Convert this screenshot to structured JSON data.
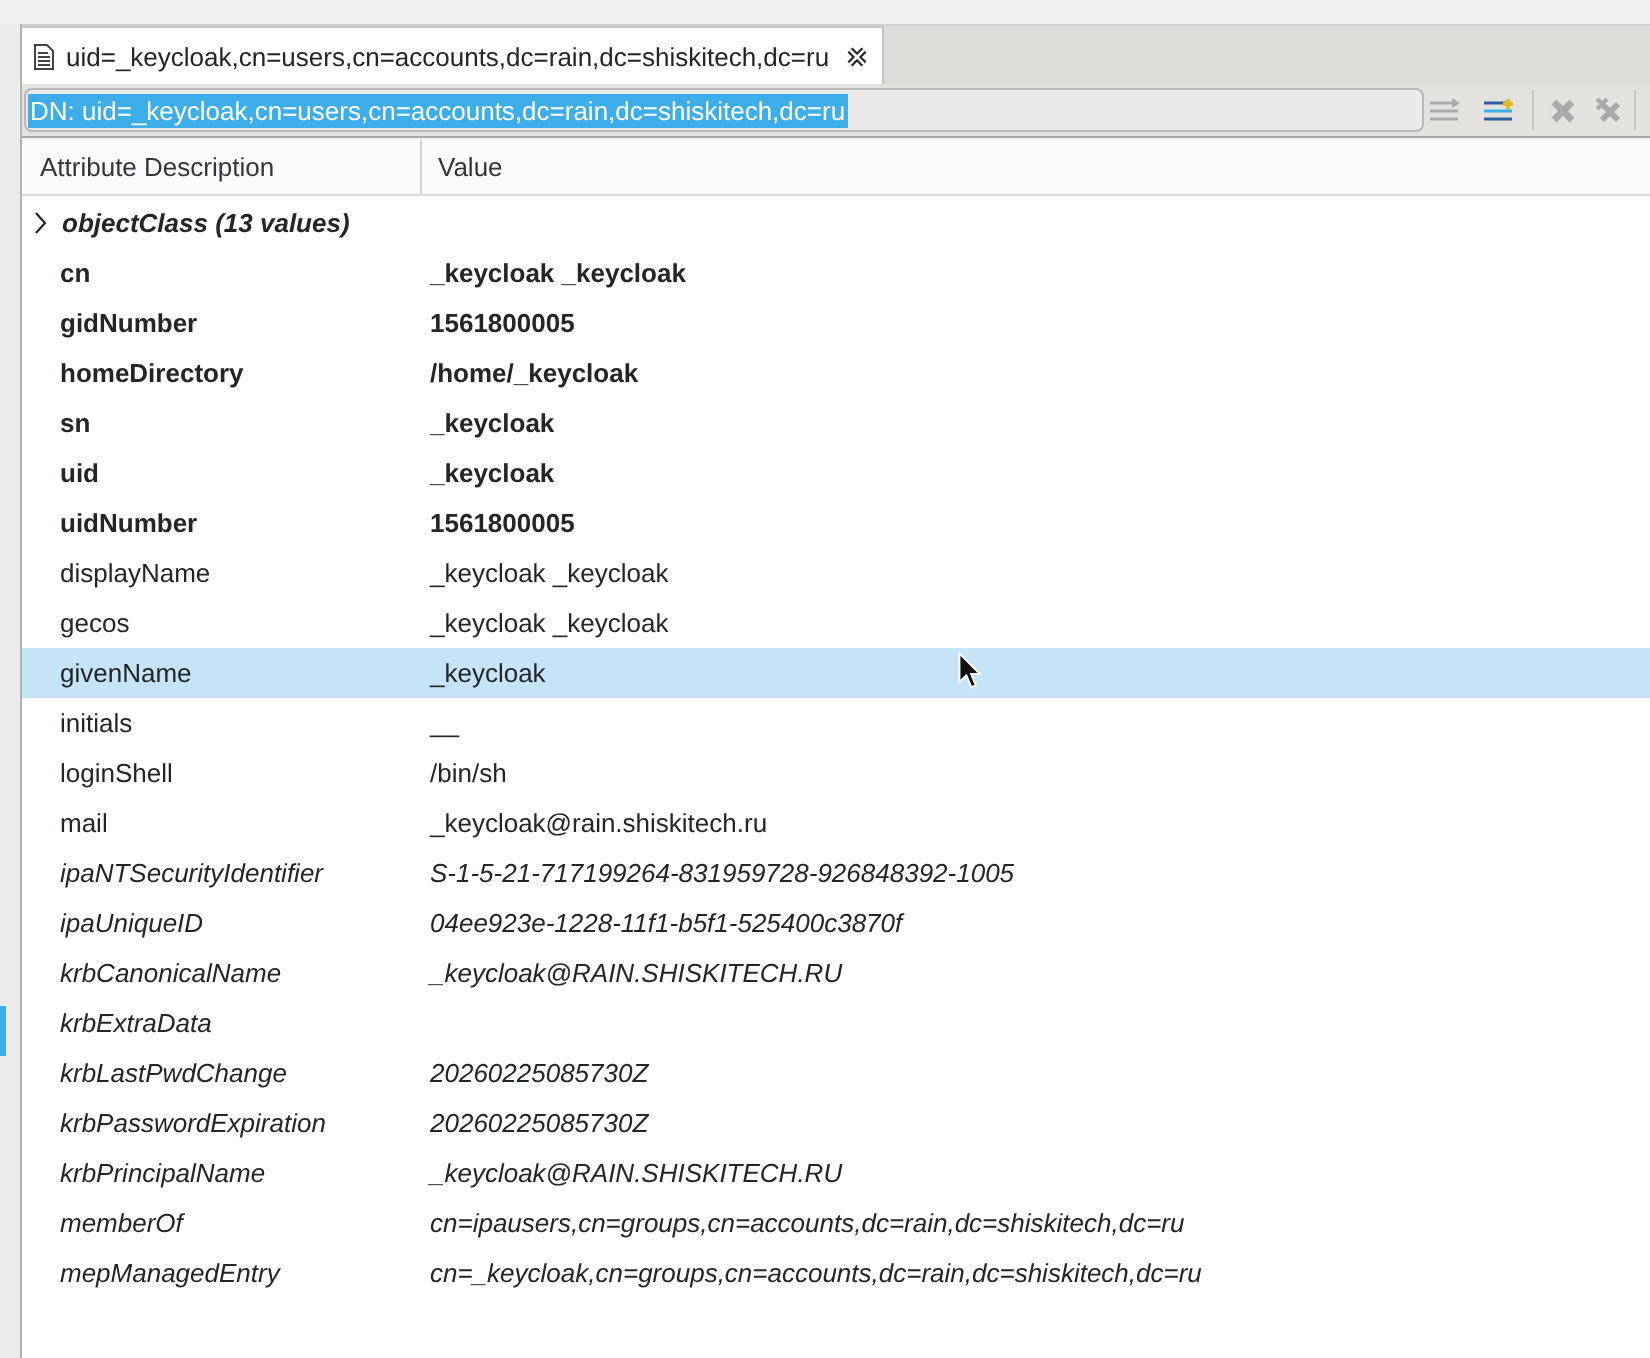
{
  "tabs": [
    {
      "title": "uid=_keycloak,cn=users,cn=accounts,dc=rain,dc=shiskitech,dc=ru",
      "selected": true
    }
  ],
  "dn_field": {
    "value": "DN: uid=_keycloak,cn=users,cn=accounts,dc=rain,dc=shiskitech,dc=ru",
    "highlighted": true
  },
  "toolbar": [
    {
      "kind": "lines-arrow",
      "disabled": true
    },
    {
      "kind": "lines-plus",
      "disabled": false
    },
    {
      "kind": "cross",
      "disabled": true
    },
    {
      "kind": "cross-all",
      "disabled": true
    }
  ],
  "table": {
    "columns": [
      "Attribute Description",
      "Value"
    ],
    "object_class": {
      "label": "objectClass (13 values)",
      "expanded": false,
      "selected": false
    },
    "rows": [
      {
        "kind": "bold",
        "name": "cn",
        "value": "_keycloak _keycloak",
        "selected": false
      },
      {
        "kind": "bold",
        "name": "gidNumber",
        "value": "1561800005",
        "selected": false
      },
      {
        "kind": "bold",
        "name": "homeDirectory",
        "value": "/home/_keycloak",
        "selected": false
      },
      {
        "kind": "bold",
        "name": "sn",
        "value": "_keycloak",
        "selected": false
      },
      {
        "kind": "bold",
        "name": "uid",
        "value": "_keycloak",
        "selected": false
      },
      {
        "kind": "bold",
        "name": "uidNumber",
        "value": "1561800005",
        "selected": false
      },
      {
        "kind": "regular",
        "name": "displayName",
        "value": "_keycloak _keycloak",
        "selected": false
      },
      {
        "kind": "regular",
        "name": "gecos",
        "value": "_keycloak _keycloak",
        "selected": false
      },
      {
        "kind": "regular",
        "name": "givenName",
        "value": "_keycloak",
        "selected": true
      },
      {
        "kind": "regular",
        "name": "initials",
        "value": "__",
        "selected": false
      },
      {
        "kind": "regular",
        "name": "loginShell",
        "value": "/bin/sh",
        "selected": false
      },
      {
        "kind": "regular",
        "name": "mail",
        "value": "_keycloak@rain.shiskitech.ru",
        "selected": false
      },
      {
        "kind": "italic",
        "name": "ipaNTSecurityIdentifier",
        "value": "S-1-5-21-717199264-831959728-926848392-1005",
        "selected": false
      },
      {
        "kind": "italic",
        "name": "ipaUniqueID",
        "value": "04ee923e-1228-11f1-b5f1-525400c3870f",
        "selected": false
      },
      {
        "kind": "italic",
        "name": "krbCanonicalName",
        "value": "_keycloak@RAIN.SHISKITECH.RU",
        "selected": false
      },
      {
        "kind": "italic",
        "name": "krbExtraData",
        "selected": false
      },
      {
        "kind": "italic",
        "name": "krbLastPwdChange",
        "value": "20260225085730Z",
        "selected": false
      },
      {
        "kind": "italic",
        "name": "krbPasswordExpiration",
        "value": "20260225085730Z",
        "selected": false
      },
      {
        "kind": "italic",
        "name": "krbPrincipalName",
        "value": "_keycloak@RAIN.SHISKITECH.RU",
        "selected": false
      },
      {
        "kind": "italic",
        "name": "memberOf",
        "value": "cn=ipausers,cn=groups,cn=accounts,dc=rain,dc=shiskitech,dc=ru",
        "selected": false
      },
      {
        "kind": "italic",
        "name": "mepManagedEntry",
        "value": "cn=_keycloak,cn=groups,cn=accounts,dc=rain,dc=shiskitech,dc=ru",
        "selected": false
      }
    ]
  }
}
